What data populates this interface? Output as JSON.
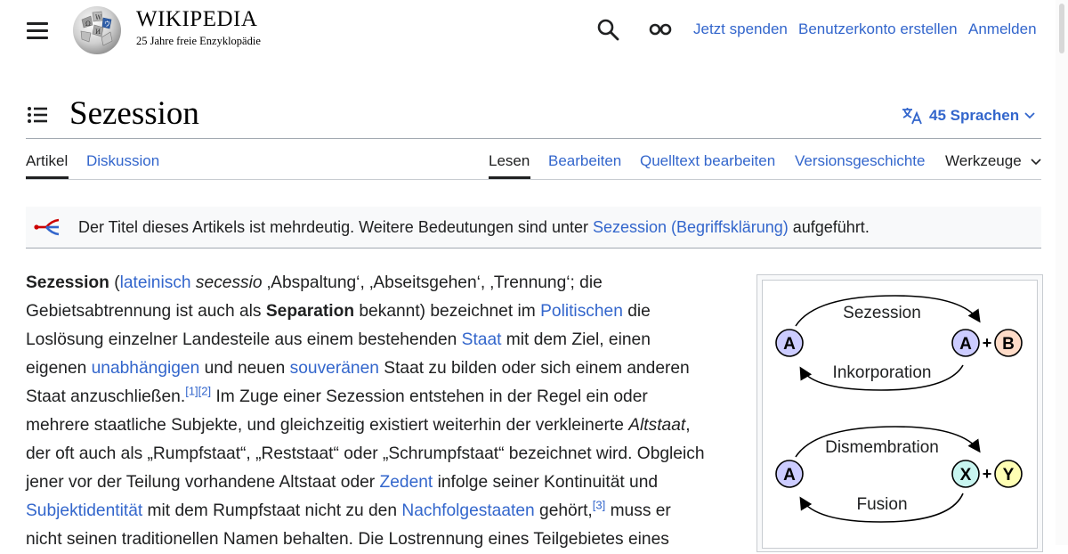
{
  "header": {
    "wordmark": "WIKIPEDIA",
    "tagline": "25 Jahre freie Enzyklopädie",
    "links": [
      "Jetzt spenden",
      "Benutzerkonto erstellen",
      "Anmelden"
    ],
    "icons": [
      "menu-icon",
      "search-icon",
      "infinity-icon"
    ]
  },
  "title": {
    "text": "Sezession",
    "languages": "45 Sprachen"
  },
  "tabs": {
    "left": [
      "Artikel",
      "Diskussion"
    ],
    "right": [
      "Lesen",
      "Bearbeiten",
      "Quelltext bearbeiten",
      "Versionsgeschichte",
      "Werkzeuge"
    ]
  },
  "hatnote": {
    "before": "Der Titel dieses Artikels ist mehrdeutig. Weitere Bedeutungen sind unter ",
    "link": "Sezession (Begriffsklärung)",
    "after": " aufgeführt."
  },
  "paragraph": {
    "l1_b": "Sezession",
    "l1_a": " (",
    "l1_link": "lateinisch",
    "l1_i": " secessio",
    "l1_c": " ‚Abspaltung‘, ‚Abseitsgehen‘, ‚Trennung‘; die",
    "l2_a": "Gebietsabtrennung ist auch als ",
    "l2_b": "Separation",
    "l2_c": " bekannt) bezeichnet im ",
    "l2_link": "Politischen",
    "l2_d": " die",
    "l3_a": "Loslösung einzelner Landesteile aus einem bestehenden ",
    "l3_link": "Staat",
    "l3_b": " mit dem Ziel, einen",
    "l4_a": "eigenen ",
    "l4_link1": "unabhängigen",
    "l4_b": " und neuen ",
    "l4_link2": "souveränen",
    "l4_c": " Staat zu bilden oder sich einem anderen",
    "l5_a": "Staat anzuschließen.",
    "l5_ref1": "[1]",
    "l5_ref2": "[2]",
    "l5_b": " Im Zuge einer Sezession entstehen in der Regel ein oder",
    "l6_a": "mehrere staatliche Subjekte, und gleichzeitig existiert weiterhin der verkleinerte ",
    "l6_i": "Altstaat",
    "l6_b": ",",
    "l7": "der oft auch als „Rumpfstaat“, „Reststaat“ oder „Schrumpfstaat“ bezeichnet wird. Obgleich",
    "l8_a": "jener vor der Teilung vorhandene Altstaat oder ",
    "l8_link": "Zedent",
    "l8_b": " infolge seiner Kontinuität und",
    "l9_link1": "Subjektidentität",
    "l9_a": " mit dem Rumpfstaat nicht zu den ",
    "l9_link2": "Nachfolgestaaten",
    "l9_b": " gehört,",
    "l9_ref": "[3]",
    "l9_c": " muss er",
    "l10": "nicht seinen traditionellen Namen behalten. Die Lostrennung eines Teilgebietes eines"
  },
  "diagram": {
    "top_arrow_label": "Sezession",
    "bottom_arrow_label": "Inkorporation",
    "top2_arrow_label": "Dismembration",
    "bottom2_arrow_label": "Fusion",
    "node_a": "A",
    "node_b": "B",
    "node_x": "X",
    "node_y": "Y",
    "plus": "+",
    "colors": {
      "a": "#ccccff",
      "b": "#ffdcc8",
      "x": "#c8f5f0",
      "y": "#ffffb4"
    }
  }
}
